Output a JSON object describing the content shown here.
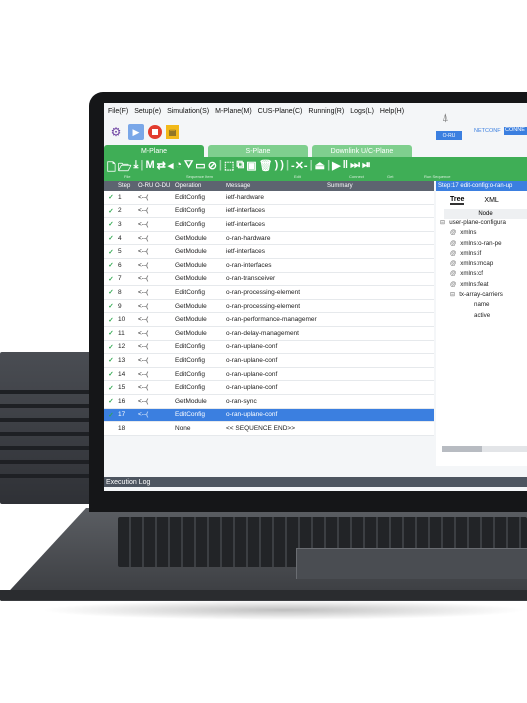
{
  "menu": [
    "File(F)",
    "Setup(e)",
    "Simulation(S)",
    "M-Plane(M)",
    "CUS-Plane(C)",
    "Running(R)",
    "Logs(L)",
    "Help(H)"
  ],
  "oru": {
    "label": "O-RU",
    "netconf": "NETCONF",
    "status": "CONNE"
  },
  "tabs": [
    {
      "label": "M-Plane",
      "color": "#3fae56"
    },
    {
      "label": "S-Plane",
      "color": "#7fcf8e"
    },
    {
      "label": "Downlink U/C-Plane",
      "color": "#7fcf8e"
    }
  ],
  "toolbar_groups": [
    "File",
    "Sequence Item",
    "Edit",
    "Connect",
    "Get",
    "Run Sequence"
  ],
  "table": {
    "headers": [
      "Step",
      "O-RU O-DU",
      "Operation",
      "Message",
      "Summary"
    ],
    "rows": [
      {
        "check": "✓",
        "step": "1",
        "dir": "<--(",
        "op": "EditConfig",
        "msg": "ietf-hardware"
      },
      {
        "check": "✓",
        "step": "2",
        "dir": "<--(",
        "op": "EditConfig",
        "msg": "ietf-interfaces"
      },
      {
        "check": "✓",
        "step": "3",
        "dir": "<--(",
        "op": "EditConfig",
        "msg": "ietf-interfaces"
      },
      {
        "check": "✓",
        "step": "4",
        "dir": "<--(",
        "op": "GetModule",
        "msg": "o-ran-hardware"
      },
      {
        "check": "✓",
        "step": "5",
        "dir": "<--(",
        "op": "GetModule",
        "msg": "ietf-interfaces"
      },
      {
        "check": "✓",
        "step": "6",
        "dir": "<--(",
        "op": "GetModule",
        "msg": "o-ran-interfaces"
      },
      {
        "check": "✓",
        "step": "7",
        "dir": "<--(",
        "op": "GetModule",
        "msg": "o-ran-transceiver"
      },
      {
        "check": "✓",
        "step": "8",
        "dir": "<--(",
        "op": "EditConfig",
        "msg": "o-ran-processing-element"
      },
      {
        "check": "✓",
        "step": "9",
        "dir": "<--(",
        "op": "GetModule",
        "msg": "o-ran-processing-element"
      },
      {
        "check": "✓",
        "step": "10",
        "dir": "<--(",
        "op": "GetModule",
        "msg": "o-ran-performance-managemer"
      },
      {
        "check": "✓",
        "step": "11",
        "dir": "<--(",
        "op": "GetModule",
        "msg": "o-ran-delay-management"
      },
      {
        "check": "✓",
        "step": "12",
        "dir": "<--(",
        "op": "EditConfig",
        "msg": "o-ran-uplane-conf"
      },
      {
        "check": "✓",
        "step": "13",
        "dir": "<--(",
        "op": "EditConfig",
        "msg": "o-ran-uplane-conf"
      },
      {
        "check": "✓",
        "step": "14",
        "dir": "<--(",
        "op": "EditConfig",
        "msg": "o-ran-uplane-conf"
      },
      {
        "check": "✓",
        "step": "15",
        "dir": "<--(",
        "op": "EditConfig",
        "msg": "o-ran-uplane-conf"
      },
      {
        "check": "✓",
        "step": "16",
        "dir": "<--(",
        "op": "GetModule",
        "msg": "o-ran-sync"
      },
      {
        "check": "✓",
        "step": "17",
        "dir": "<--(",
        "op": "EditConfig",
        "msg": "o-ran-uplane-conf",
        "selected": true
      },
      {
        "check": "",
        "step": "18",
        "dir": "",
        "op": "None",
        "msg": "<< SEQUENCE END>>"
      }
    ]
  },
  "right_panel": {
    "header": "Step:17 edit-config:o-ran-up",
    "tabs": [
      "Tree",
      "XML"
    ],
    "node_header": "Node",
    "tree": [
      {
        "prefix": "⊟",
        "text": "user-plane-configura",
        "indent": 4
      },
      {
        "prefix": "@",
        "text": "xmlns",
        "indent": 14
      },
      {
        "prefix": "@",
        "text": "xmlns:o-ran-pe",
        "indent": 14
      },
      {
        "prefix": "@",
        "text": "xmlns:if",
        "indent": 14
      },
      {
        "prefix": "@",
        "text": "xmlns:mcap",
        "indent": 14
      },
      {
        "prefix": "@",
        "text": "xmlns:cf",
        "indent": 14
      },
      {
        "prefix": "@",
        "text": "xmlns:feat",
        "indent": 14
      },
      {
        "prefix": "⊟",
        "text": "tx-array-carriers",
        "indent": 14
      },
      {
        "prefix": "",
        "text": "name",
        "indent": 34
      },
      {
        "prefix": "",
        "text": "active",
        "indent": 34
      }
    ]
  },
  "status_bar": "Execution Log"
}
